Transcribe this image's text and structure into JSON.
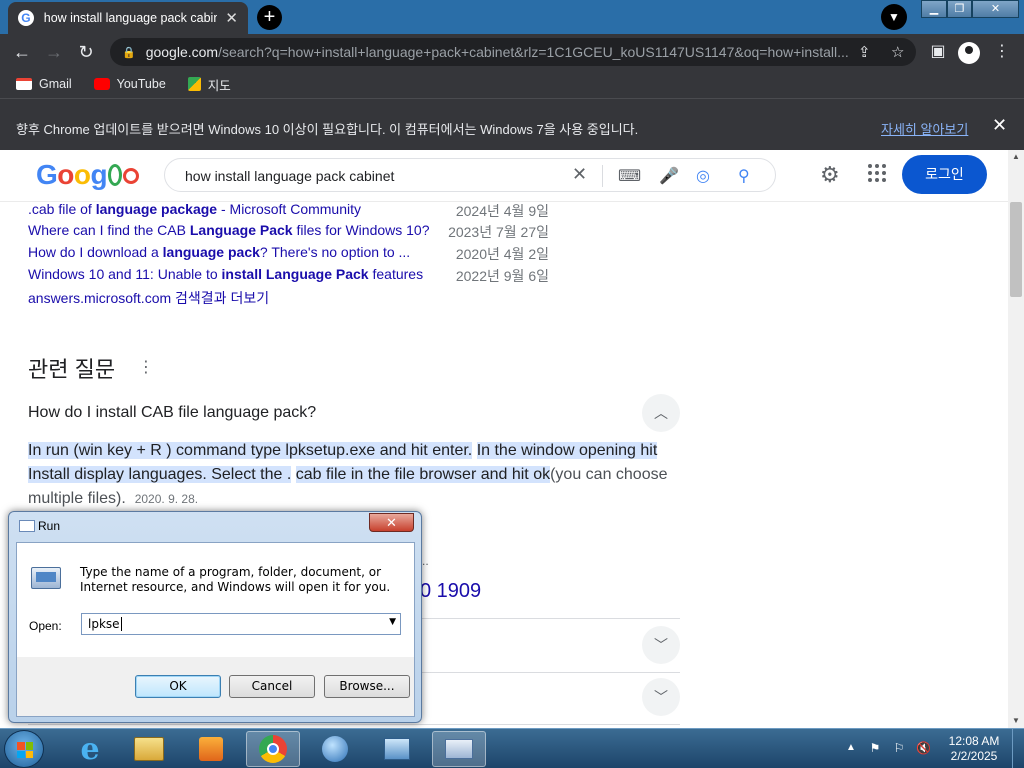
{
  "browser": {
    "tab_title": "how install language pack cabinet",
    "tab_close": "✕",
    "new_tab": "+",
    "url_host": "google.com",
    "url_rest": "/search?q=how+install+language+pack+cabinet&rlz=1C1GCEU_koUS1147US1147&oq=how+install...",
    "bookmarks": [
      {
        "label": "Gmail",
        "icon": "gmail-icon"
      },
      {
        "label": "YouTube",
        "icon": "youtube-icon"
      },
      {
        "label": "지도",
        "icon": "maps-icon"
      }
    ]
  },
  "infobar": {
    "message": "향후 Chrome 업데이트를 받으려면 Windows 10 이상이 필요합니다. 이 컴퓨터에서는 Windows 7을 사용 중입니다.",
    "learn_more": "자세히 알아보기",
    "close": "✕"
  },
  "google": {
    "logo_letters": [
      "G",
      "o",
      "o",
      "g",
      "",
      ""
    ],
    "query": "how install language pack cabinet",
    "login": "로그인"
  },
  "results": {
    "links": [
      {
        "pre": ".cab file of ",
        "bold": "language package",
        "post": " - Microsoft Community",
        "date": "2024년 4월 9일"
      },
      {
        "pre": "Where can I find the CAB ",
        "bold": "Language Pack",
        "post": " files for Windows 10?",
        "date": "2023년 7월 27일"
      },
      {
        "pre": "How do I download a ",
        "bold": "language pack",
        "post": "? There's no option to ...",
        "date": "2020년 4월 2일"
      },
      {
        "pre": "Windows 10 and 11: Unable to ",
        "bold": "install Language Pack",
        "post": " features",
        "date": "2022년 9월 6일"
      }
    ],
    "more": "answers.microsoft.com 검색결과 더보기"
  },
  "paa": {
    "title": "관련 질문",
    "question1": "How do I install CAB file language pack?",
    "answer_parts": [
      {
        "text": "In run (win key + R ) command type lpksetup.exe and hit enter.",
        "hl": true
      },
      {
        "text": " ",
        "hl": false
      },
      {
        "text": "In the window opening hit Install display languages. Select the .",
        "hl": true
      },
      {
        "text": " ",
        "hl": false
      },
      {
        "text": "cab file in the file browser and hit ok",
        "hl": true
      },
      {
        "text": "(you can choose multiple files).",
        "hl": false
      }
    ],
    "answer_date": "2020. 9. 28.",
    "bg_snippet": "a...",
    "bg_title": "0 1909"
  },
  "run_dialog": {
    "title": "Run",
    "description": "Type the name of a program, folder, document, or Internet resource, and Windows will open it for you.",
    "open_label": "Open:",
    "input_value": "lpkse",
    "ok": "OK",
    "cancel": "Cancel",
    "browse": "Browse..."
  },
  "taskbar": {
    "time": "12:08 AM",
    "date": "2/2/2025"
  }
}
